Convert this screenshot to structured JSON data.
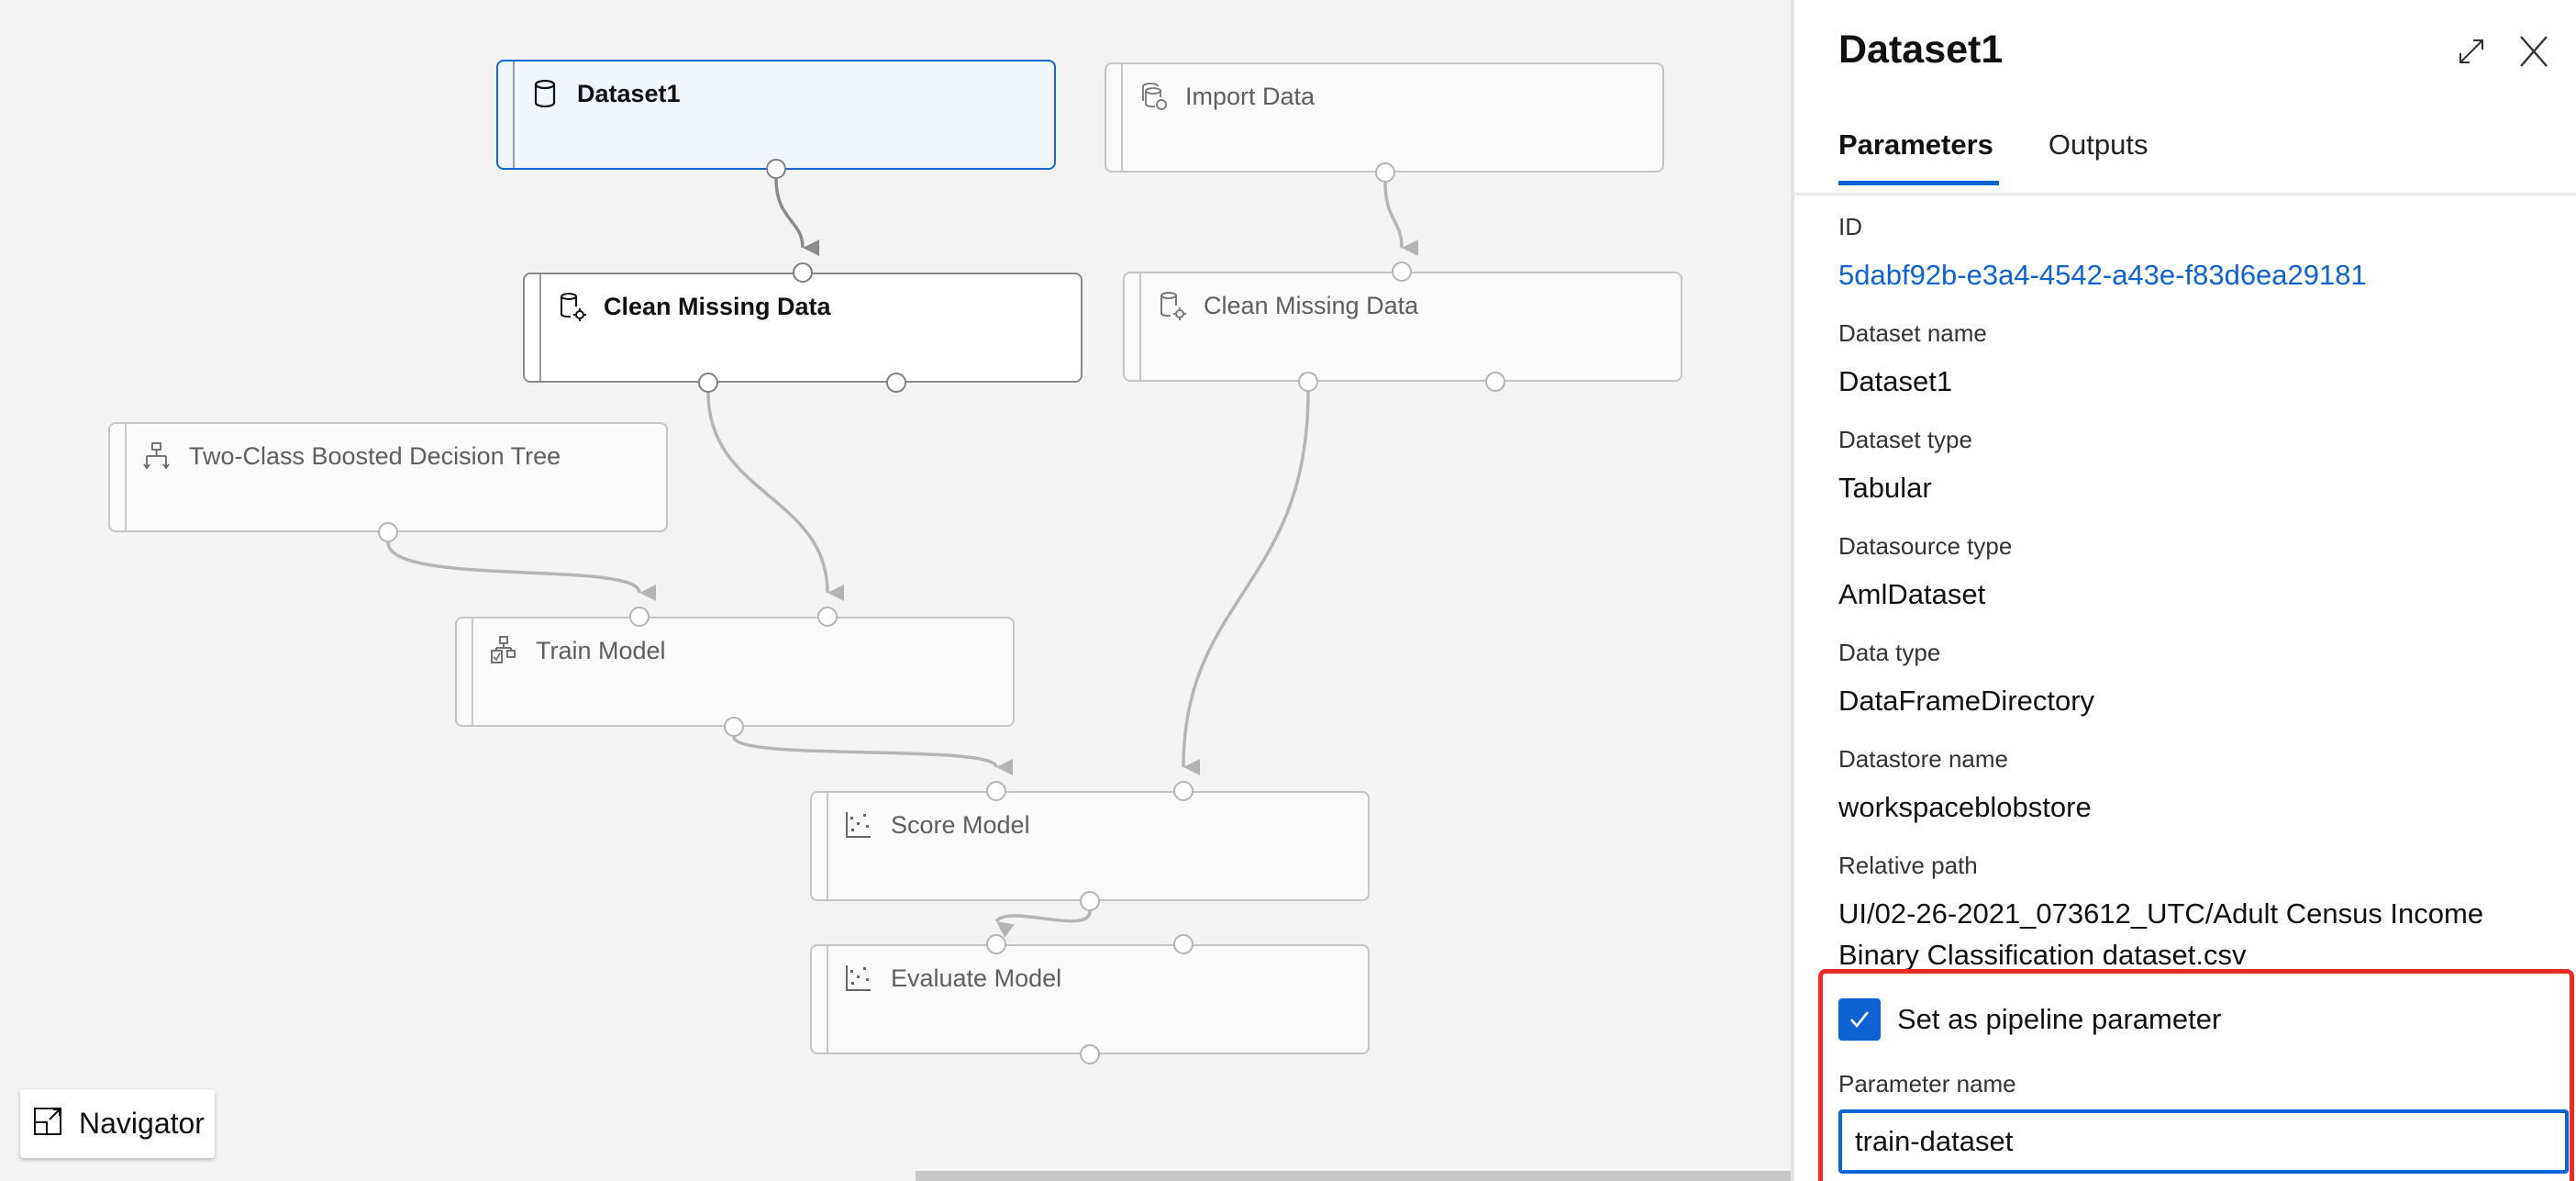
{
  "canvas": {
    "nodes": [
      {
        "id": "dataset1",
        "title": "Dataset1",
        "icon": "dataset-cylinder-icon",
        "state": "selected"
      },
      {
        "id": "import-data",
        "title": "Import Data",
        "icon": "import-data-icon",
        "state": "dimmed"
      },
      {
        "id": "clean-missing-left",
        "title": "Clean Missing Data",
        "icon": "clean-data-icon",
        "state": "active"
      },
      {
        "id": "clean-missing-right",
        "title": "Clean Missing Data",
        "icon": "clean-data-icon",
        "state": "dimmed"
      },
      {
        "id": "two-class-bdt",
        "title": "Two-Class Boosted Decision Tree",
        "icon": "decision-tree-icon",
        "state": "dimmed"
      },
      {
        "id": "train-model",
        "title": "Train Model",
        "icon": "train-model-icon",
        "state": "dimmed"
      },
      {
        "id": "score-model",
        "title": "Score Model",
        "icon": "scatter-chart-icon",
        "state": "dimmed"
      },
      {
        "id": "evaluate-model",
        "title": "Evaluate Model",
        "icon": "scatter-chart-icon",
        "state": "dimmed"
      }
    ],
    "connections": [
      {
        "from": "dataset1",
        "to": "clean-missing-left"
      },
      {
        "from": "import-data",
        "to": "clean-missing-right"
      },
      {
        "from": "two-class-bdt",
        "to": "train-model"
      },
      {
        "from": "clean-missing-left",
        "to": "train-model"
      },
      {
        "from": "train-model",
        "to": "score-model"
      },
      {
        "from": "clean-missing-right",
        "to": "score-model"
      },
      {
        "from": "score-model",
        "to": "evaluate-model"
      }
    ],
    "navigator_label": "Navigator"
  },
  "panel": {
    "title": "Dataset1",
    "tabs": [
      {
        "label": "Parameters",
        "active": true
      },
      {
        "label": "Outputs",
        "active": false
      }
    ],
    "properties": [
      {
        "label": "ID",
        "value": "5dabf92b-e3a4-4542-a43e-f83d6ea29181",
        "link": true
      },
      {
        "label": "Dataset name",
        "value": "Dataset1"
      },
      {
        "label": "Dataset type",
        "value": "Tabular"
      },
      {
        "label": "Datasource type",
        "value": "AmlDataset"
      },
      {
        "label": "Data type",
        "value": "DataFrameDirectory"
      },
      {
        "label": "Datastore name",
        "value": "workspaceblobstore"
      },
      {
        "label": "Relative path",
        "value": "UI/02-26-2021_073612_UTC/Adult Census Income Binary Classification dataset.csv"
      }
    ],
    "pipeline_parameter": {
      "checkbox_label": "Set as pipeline parameter",
      "checked": true,
      "name_label": "Parameter name",
      "name_value": "train-dataset"
    }
  },
  "colors": {
    "accent": "#0f62d4",
    "highlight": "#ee2b24",
    "edge": "#b4b4b4",
    "edge_active": "#8a8a8a"
  }
}
